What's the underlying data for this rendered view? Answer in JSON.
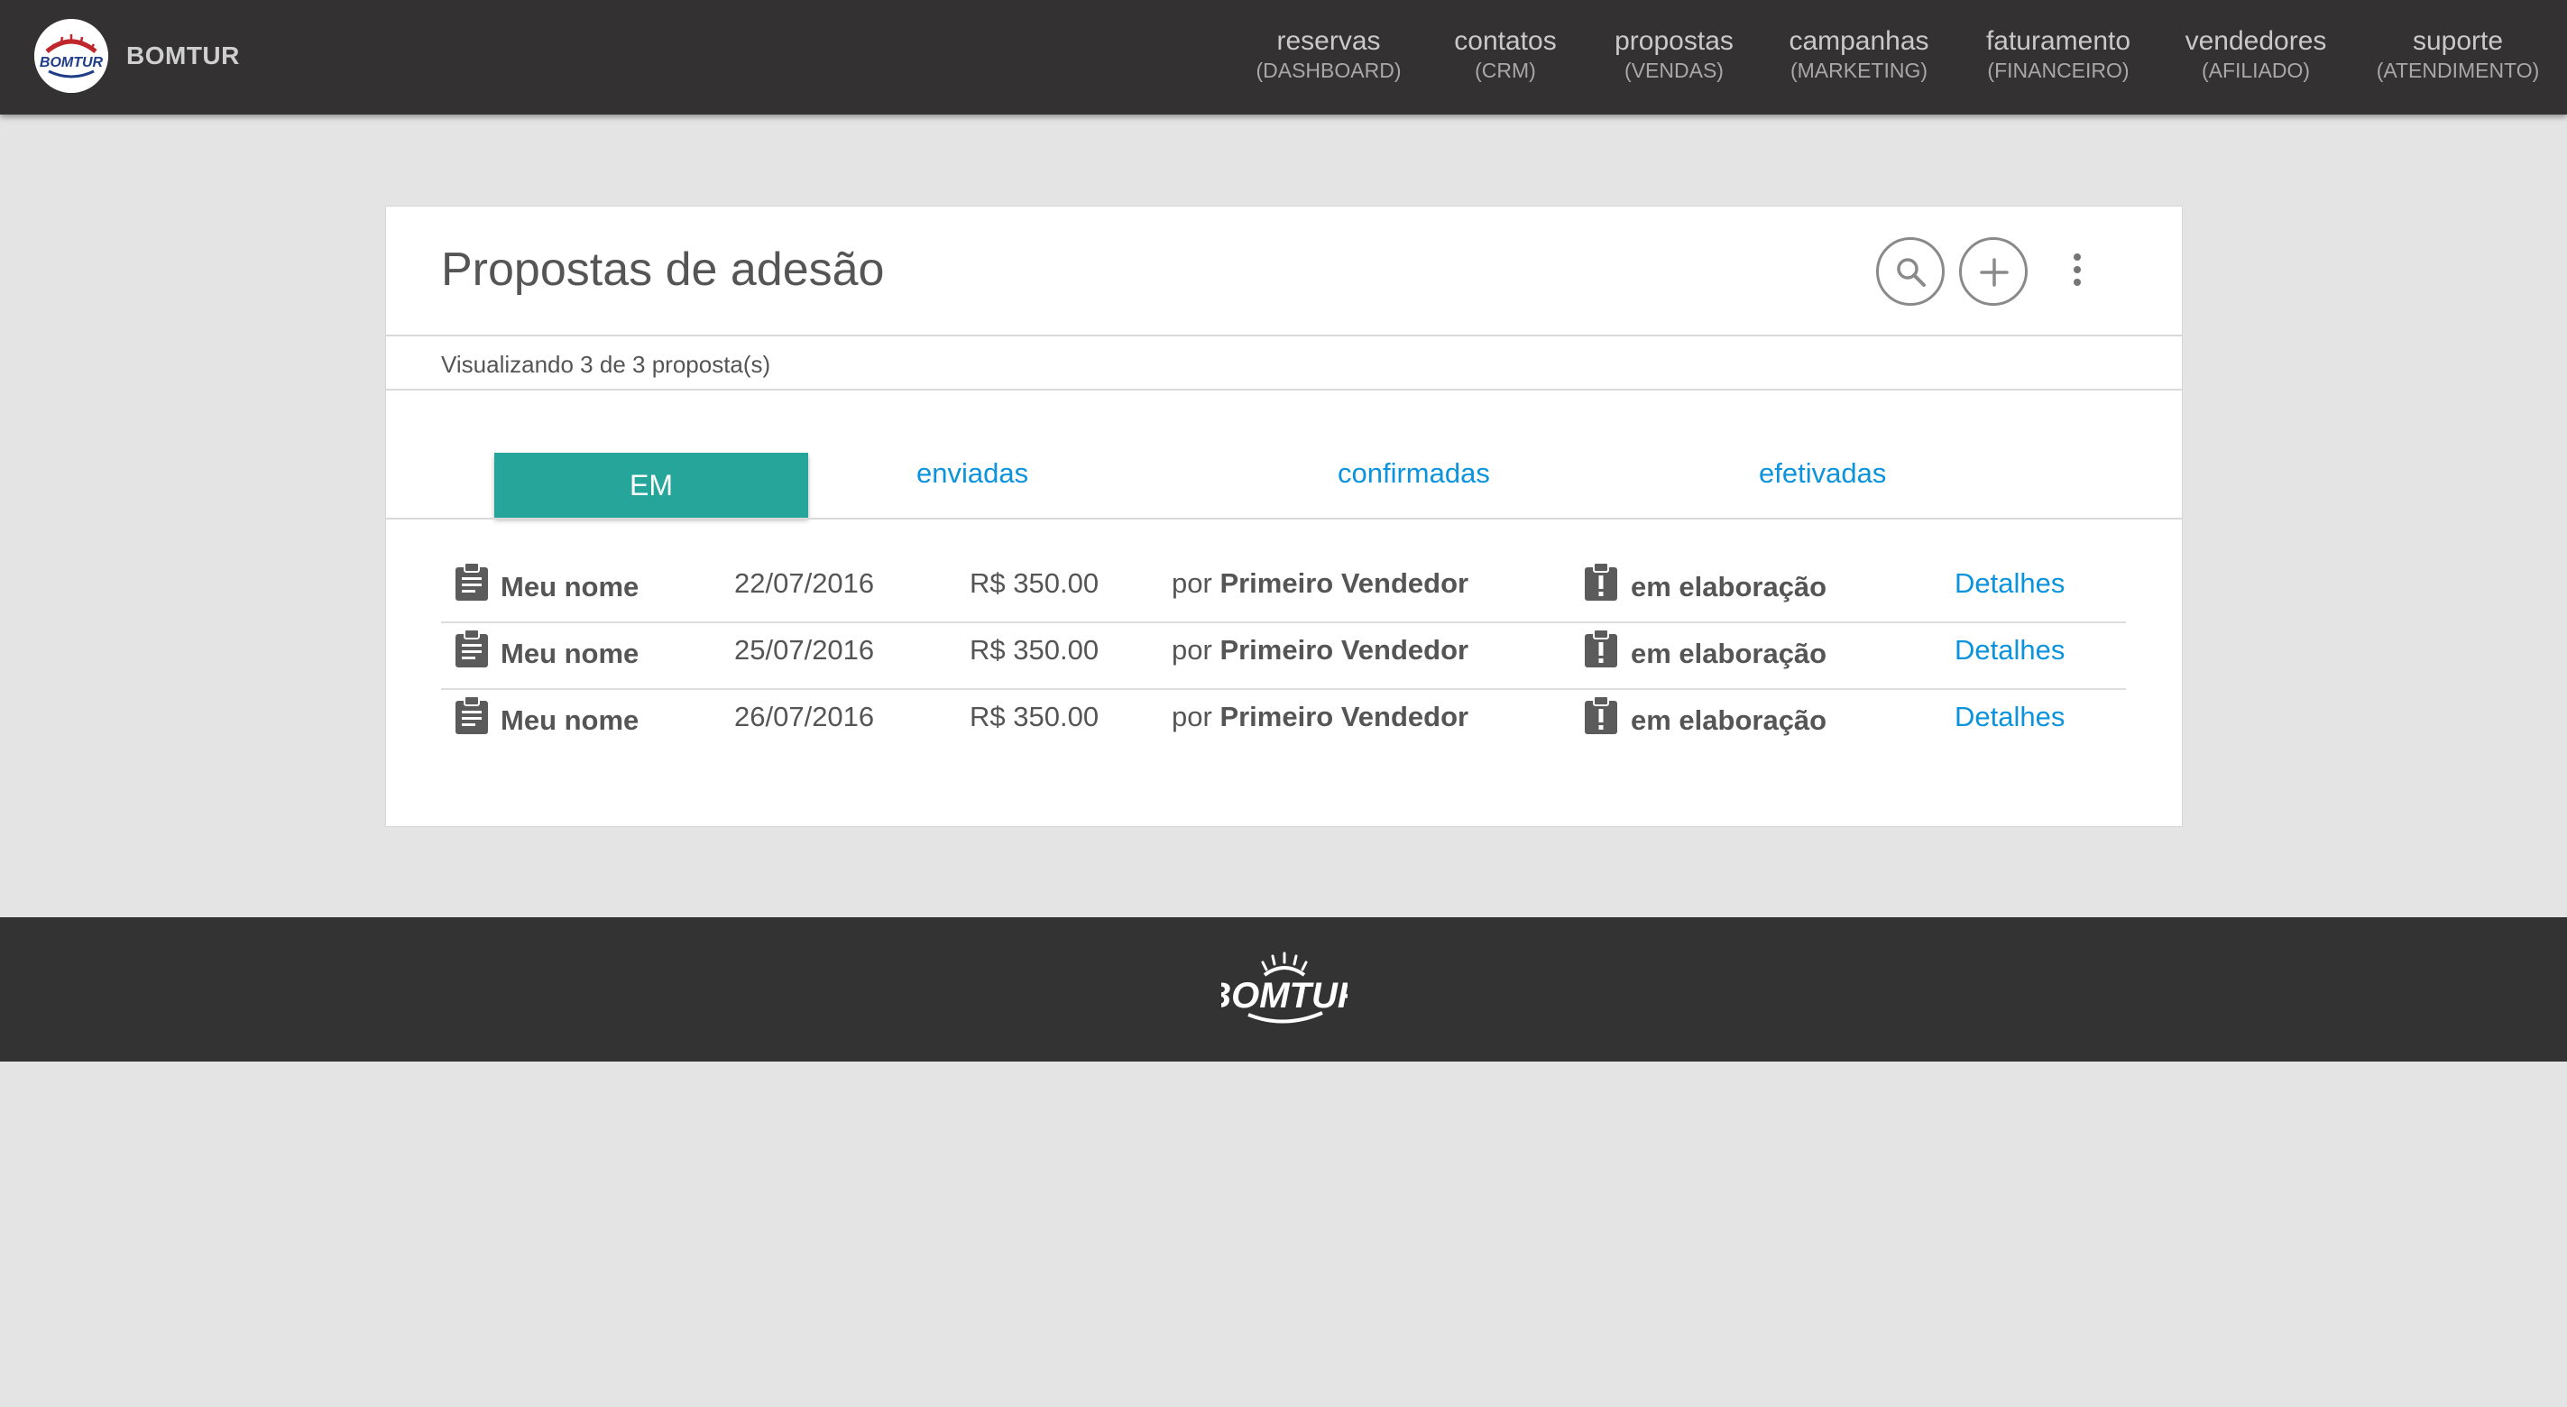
{
  "brand": {
    "name": "BOMTUR",
    "logo_text": "BOMTUR"
  },
  "nav": [
    {
      "label": "reservas",
      "sub": "(DASHBOARD)"
    },
    {
      "label": "contatos",
      "sub": "(CRM)"
    },
    {
      "label": "propostas",
      "sub": "(VENDAS)"
    },
    {
      "label": "campanhas",
      "sub": "(MARKETING)"
    },
    {
      "label": "faturamento",
      "sub": "(FINANCEIRO)"
    },
    {
      "label": "vendedores",
      "sub": "(AFILIADO)"
    },
    {
      "label": "suporte",
      "sub": "(ATENDIMENTO)"
    }
  ],
  "card": {
    "title": "Propostas de adesão",
    "count_text": "Visualizando 3 de 3 proposta(s)",
    "actions": {
      "search_icon": "search-icon",
      "add_icon": "plus-icon",
      "more_icon": "more-vert-icon"
    }
  },
  "tabs": [
    {
      "label": "EM",
      "active": true
    },
    {
      "label": "enviadas",
      "active": false
    },
    {
      "label": "confirmadas",
      "active": false
    },
    {
      "label": "efetivadas",
      "active": false
    }
  ],
  "proposals": [
    {
      "name": "Meu nome",
      "date": "22/07/2016",
      "value": "R$ 350.00",
      "by_prefix": "por",
      "seller": "Primeiro Vendedor",
      "status": "em elaboração",
      "action": "Detalhes"
    },
    {
      "name": "Meu nome",
      "date": "25/07/2016",
      "value": "R$ 350.00",
      "by_prefix": "por",
      "seller": "Primeiro Vendedor",
      "status": "em elaboração",
      "action": "Detalhes"
    },
    {
      "name": "Meu nome",
      "date": "26/07/2016",
      "value": "R$ 350.00",
      "by_prefix": "por",
      "seller": "Primeiro Vendedor",
      "status": "em elaboração",
      "action": "Detalhes"
    }
  ],
  "footer": {
    "logo_text": "BOMTUR"
  },
  "colors": {
    "navbar": "#333132",
    "accent": "#26a69a",
    "link": "#0b93dc",
    "page_bg": "#e4e4e4",
    "footer": "#333333"
  }
}
